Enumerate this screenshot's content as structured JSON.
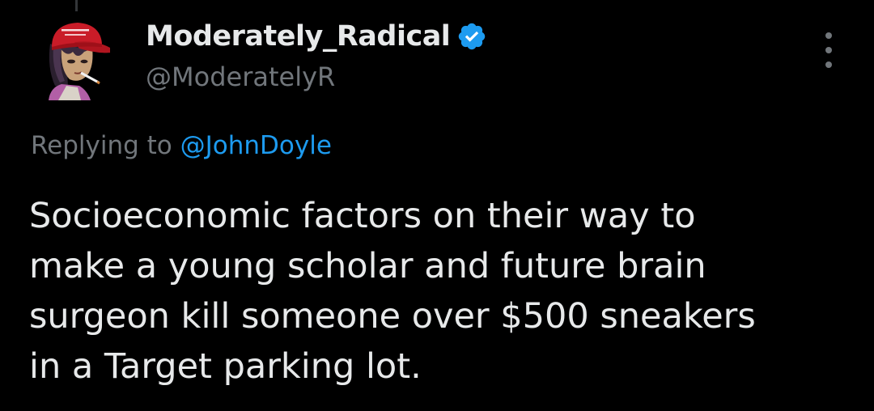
{
  "tweet": {
    "author": {
      "display_name": "Moderately_Radical",
      "handle": "@ModeratelyR",
      "verified": true,
      "avatar_hat_text": "MAKE AMERICA GREAT AGAIN"
    },
    "reply": {
      "prefix": "Replying to",
      "mention": "@JohnDoyle"
    },
    "text_lines": [
      "Socioeconomic factors on their way to",
      "make a young scholar and future brain",
      "surgeon kill someone over $500 sneakers",
      "in a Target parking lot."
    ],
    "more_icon": "more-vertical-icon"
  },
  "colors": {
    "background": "#000000",
    "primary_text": "#e7e9ea",
    "secondary_text": "#71767b",
    "accent": "#1d9bf0"
  }
}
